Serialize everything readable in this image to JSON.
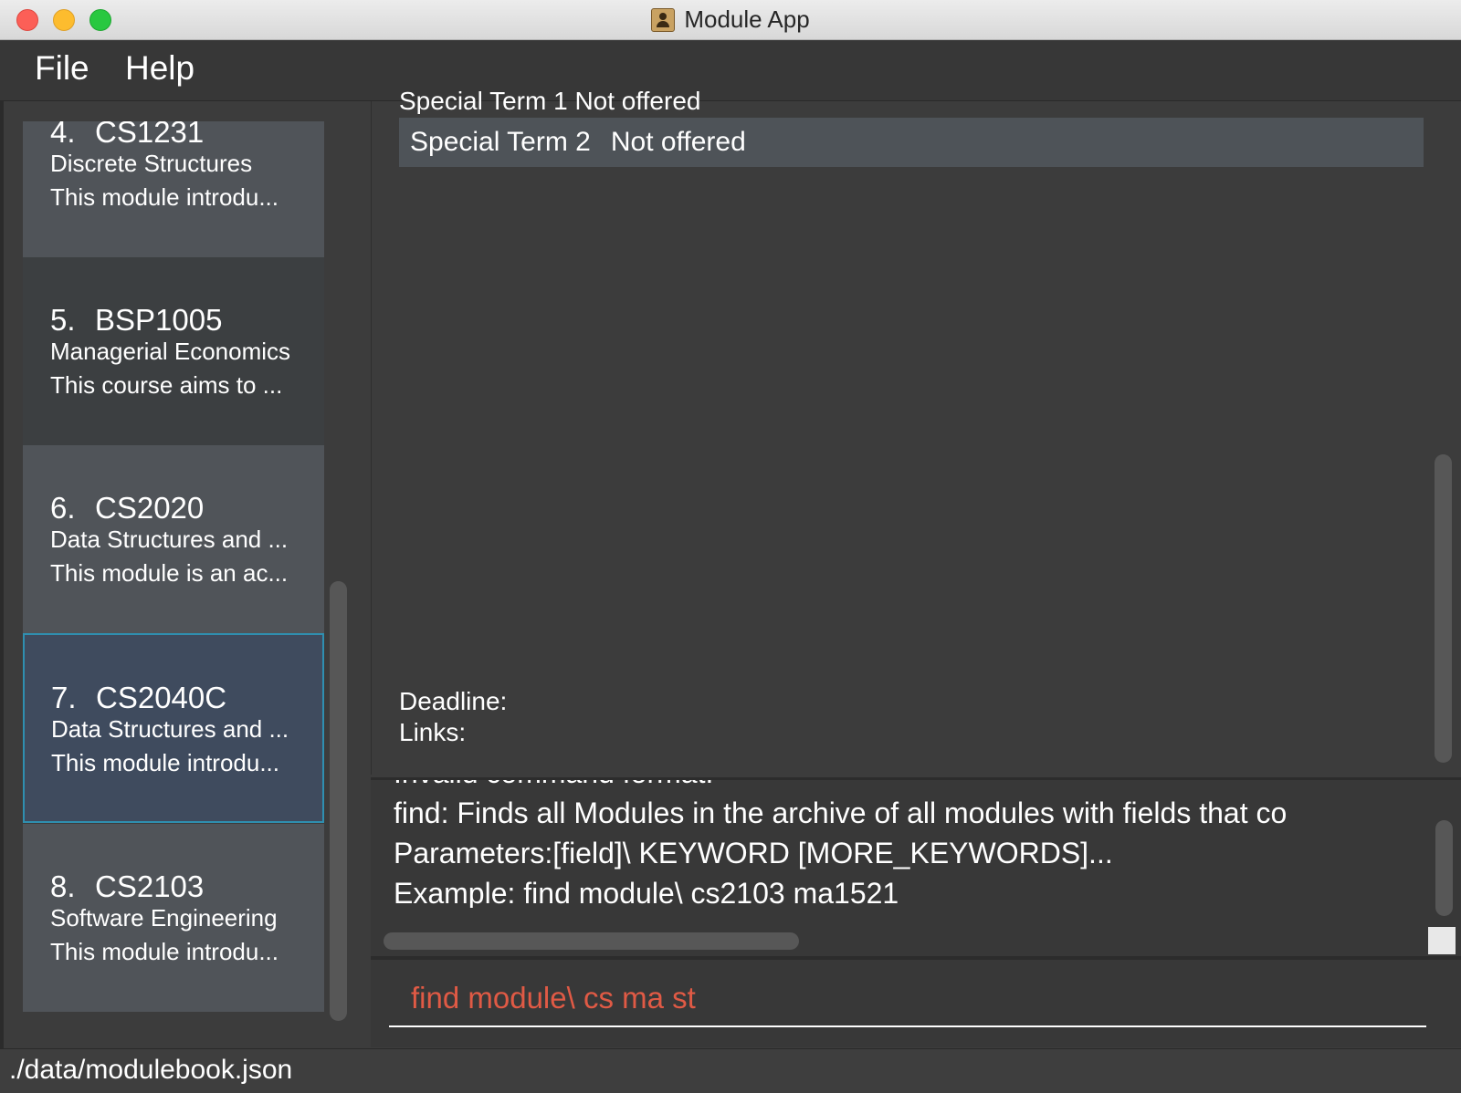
{
  "window": {
    "title": "Module App"
  },
  "menu": {
    "items": [
      "File",
      "Help"
    ]
  },
  "module_list": [
    {
      "index": "4.",
      "code": "CS1231",
      "title": "Discrete Structures",
      "desc": "This module introdu...",
      "selected": false
    },
    {
      "index": "5.",
      "code": "BSP1005",
      "title": "Managerial Economics",
      "desc": "This course aims to ...",
      "selected": false
    },
    {
      "index": "6.",
      "code": "CS2020",
      "title": "Data Structures and ...",
      "desc": "This module is an ac...",
      "selected": false
    },
    {
      "index": "7.",
      "code": "CS2040C",
      "title": "Data Structures and ...",
      "desc": "This module introdu...",
      "selected": true
    },
    {
      "index": "8.",
      "code": "CS2103",
      "title": "Software Engineering",
      "desc": "This module introdu...",
      "selected": false
    }
  ],
  "detail": {
    "cut_off_text": "Special Term 1   Not offered",
    "term_row": {
      "label": "Special Term 2",
      "value": "Not offered"
    },
    "deadline_label": "Deadline:",
    "links_label": "Links:"
  },
  "result": {
    "lines": [
      "Invalid command format!",
      "find: Finds all Modules in the archive of all modules with fields that co",
      "Parameters:[field]\\ KEYWORD [MORE_KEYWORDS]...",
      "Example: find module\\ cs2103 ma1521"
    ]
  },
  "command": {
    "value": "find module\\ cs ma st",
    "text_color": "#e05a45"
  },
  "status": {
    "path": "./data/modulebook.json"
  },
  "colors": {
    "selected_border": "#2f8fb0",
    "selected_bg": "#3f4b5e",
    "card_alt_bg": "#505459"
  }
}
